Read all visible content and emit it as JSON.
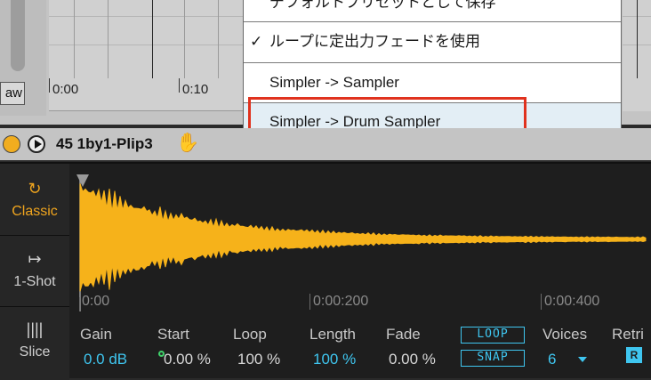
{
  "top": {
    "aw_label": "aw",
    "ruler": [
      "0:00",
      "0:10"
    ]
  },
  "menu": {
    "items": [
      {
        "label": "デフォルトプリセットとして保存"
      },
      {
        "label": "ループに定出力フェードを使用",
        "check": "✓"
      },
      {
        "label": "Simpler -> Sampler"
      },
      {
        "label": "Simpler -> Drum Sampler"
      }
    ]
  },
  "clip": {
    "name": "45 1by1-Plip3"
  },
  "simpler": {
    "modes": [
      {
        "label": "Classic",
        "icon": "loop-arrow-icon"
      },
      {
        "label": "1-Shot",
        "icon": "one-shot-arrow-icon"
      },
      {
        "label": "Slice",
        "icon": "slice-bars-icon"
      }
    ],
    "selected_mode": "Classic",
    "time_labels": [
      "0:00",
      "0:00:200",
      "0:00:400"
    ],
    "params": {
      "gain": {
        "label": "Gain",
        "value": "0.0 dB"
      },
      "start": {
        "label": "Start",
        "value": "0.00 %"
      },
      "loop": {
        "label": "Loop",
        "value": "100 %"
      },
      "length": {
        "label": "Length",
        "value": "100 %"
      },
      "fade": {
        "label": "Fade",
        "value": "0.00 %"
      },
      "loop_button": "LOOP",
      "snap_button": "SNAP",
      "voices": {
        "label": "Voices",
        "value": "6"
      },
      "retrig": {
        "label": "Retri",
        "button": "R"
      }
    }
  },
  "colors": {
    "accent_orange": "#f0a51e",
    "value_blue": "#3fc6f0",
    "highlight_red": "#e0321e",
    "waveform": "#f6b21a"
  }
}
